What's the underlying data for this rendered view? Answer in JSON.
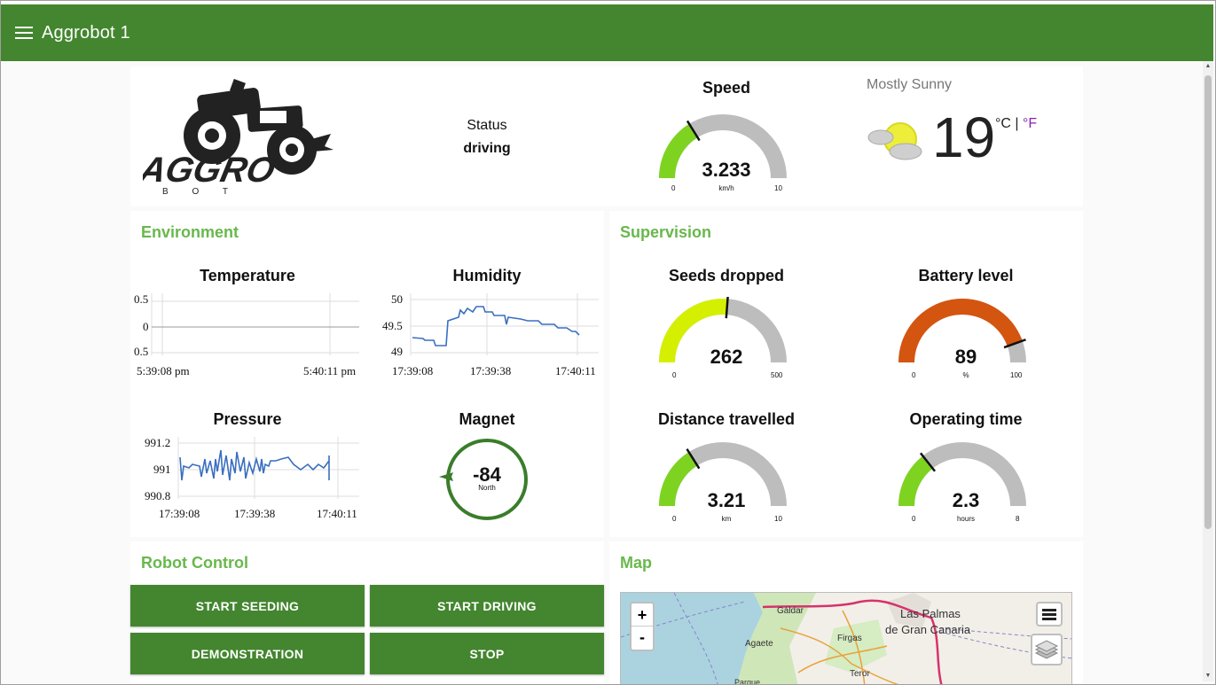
{
  "app": {
    "title": "Aggrobot 1"
  },
  "status": {
    "label": "Status",
    "value": "driving"
  },
  "logo": {
    "text": "AGGRO",
    "sub": "B O T"
  },
  "speed": {
    "title": "Speed",
    "value": 3.233,
    "unit": "km/h",
    "min": 0,
    "max": 10,
    "color": "#7ed321"
  },
  "weather": {
    "condition": "Mostly Sunny",
    "temp": "19",
    "unit_c": "°C",
    "sep": "|",
    "unit_f": "°F",
    "icon": "partly-sunny-icon"
  },
  "environment": {
    "title": "Environment",
    "temperature": {
      "title": "Temperature",
      "yticks": [
        "0.5",
        "0",
        "0.5"
      ],
      "xticks": [
        "5:39:08 pm",
        "5:40:11 pm"
      ]
    },
    "humidity": {
      "title": "Humidity",
      "yticks": [
        "50",
        "49.5",
        "49"
      ],
      "xticks": [
        "17:39:08",
        "17:39:38",
        "17:40:11"
      ]
    },
    "pressure": {
      "title": "Pressure",
      "yticks": [
        "991.2",
        "991",
        "990.8"
      ],
      "xticks": [
        "17:39:08",
        "17:39:38",
        "17:40:11"
      ]
    },
    "magnet": {
      "title": "Magnet",
      "value": "-84",
      "direction": "North"
    }
  },
  "supervision": {
    "title": "Supervision",
    "seeds": {
      "title": "Seeds dropped",
      "value": 262,
      "unit": "",
      "min": 0,
      "max": 500,
      "color": "#d4f000"
    },
    "battery": {
      "title": "Battery level",
      "value": 89,
      "unit": "%",
      "min": 0,
      "max": 100,
      "color": "#d4550f"
    },
    "distance": {
      "title": "Distance travelled",
      "value": 3.21,
      "unit": "km",
      "min": 0,
      "max": 10,
      "color": "#7ed321"
    },
    "optime": {
      "title": "Operating time",
      "value": 2.3,
      "unit": "hours",
      "min": 0,
      "max": 8,
      "color": "#7ed321"
    }
  },
  "control": {
    "title": "Robot Control",
    "start_seeding": "START SEEDING",
    "start_driving": "START DRIVING",
    "demonstration": "DEMONSTRATION",
    "stop": "STOP"
  },
  "map": {
    "title": "Map",
    "zoom_in": "+",
    "zoom_out": "-",
    "places": [
      "Gáldar",
      "Las Palmas",
      "de Gran Canaria",
      "Agaete",
      "Firgas",
      "Teror",
      "Parque"
    ]
  }
}
